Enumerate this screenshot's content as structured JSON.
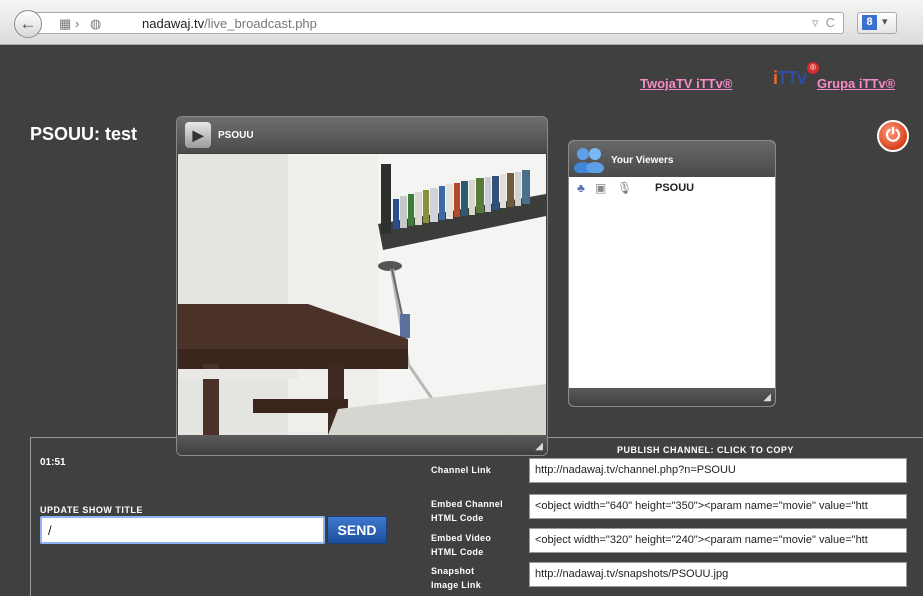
{
  "browser": {
    "url_host": "nadawaj.tv",
    "url_path": "/live_broadcast.php",
    "reload_icon": "C",
    "search_badge": "8"
  },
  "header_links": {
    "twojatv": "TwojaTV iTTv® ",
    "grupa": "Grupa iTTv®",
    "logo_text_orange": "i",
    "logo_text_blue": "TTv"
  },
  "page": {
    "title": "PSOUU: test"
  },
  "video": {
    "label": "PSOUU"
  },
  "viewers": {
    "title": "Your Viewers",
    "list": [
      {
        "name": "PSOUU"
      }
    ]
  },
  "broadcast": {
    "timer": "01:51",
    "update_label": "UPDATE SHOW TITLE",
    "title_value": "/",
    "send_label": "SEND",
    "publish_title": "PUBLISH CHANNEL: CLICK TO COPY",
    "channel_link_label": "Channel Link",
    "channel_link_value": "http://nadawaj.tv/channel.php?n=PSOUU",
    "embed_channel_label_1": "Embed Channel",
    "embed_channel_label_2": "HTML Code",
    "embed_channel_value": "<object width=\"640\" height=\"350\"><param name=\"movie\" value=\"htt",
    "embed_video_label_1": "Embed Video",
    "embed_video_label_2": "HTML Code",
    "embed_video_value": "<object width=\"320\" height=\"240\"><param name=\"movie\" value=\"htt",
    "snapshot_label_1": "Snapshot",
    "snapshot_label_2": "Image Link",
    "snapshot_value": "http://nadawaj.tv/snapshots/PSOUU.jpg"
  }
}
